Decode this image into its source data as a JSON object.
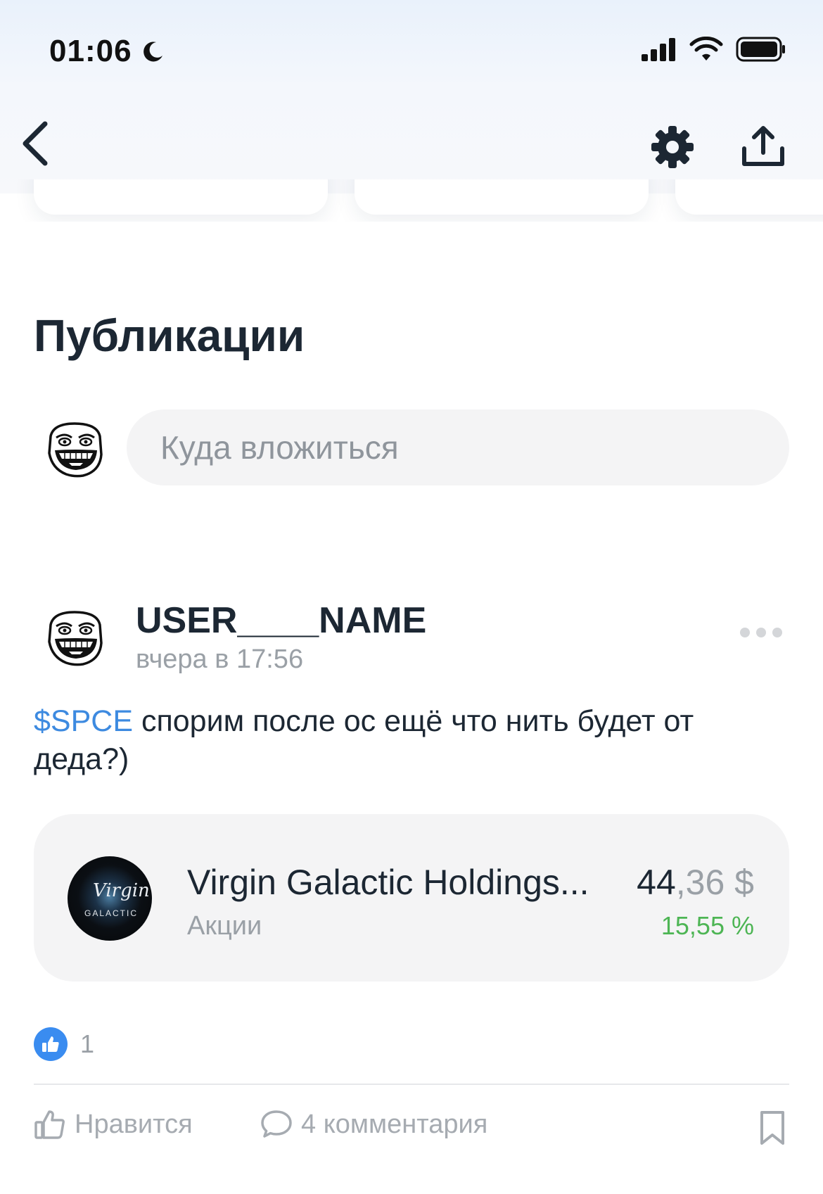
{
  "status_bar": {
    "time": "01:06"
  },
  "section": {
    "title": "Публикации"
  },
  "composer": {
    "placeholder": "Куда вложиться"
  },
  "post": {
    "author": "USER____NAME",
    "time": "вчера в 17:56",
    "ticker": "$SPCE",
    "text": " спорим после ос ещё что нить будет от деда?)",
    "stock": {
      "name": "Virgin Galactic Holdings...",
      "type": "Акции",
      "price_int": "44",
      "price_dec": ",36 $",
      "change": "15,55 %",
      "logo_mark": "Virgin",
      "logo_text": "GALACTIC"
    },
    "likes_count": "1",
    "actions": {
      "like_label": "Нравится",
      "comments_label": "4 комментария"
    }
  },
  "colors": {
    "accent": "#3d8ae0",
    "positive": "#4db554",
    "muted": "#9aa0a6",
    "text": "#1c2733"
  },
  "icons": [
    "moon-icon",
    "signal-icon",
    "wifi-icon",
    "battery-icon",
    "back-chevron-icon",
    "gear-icon",
    "share-icon",
    "more-icon",
    "thumbs-up-icon",
    "comment-icon",
    "bookmark-icon"
  ]
}
